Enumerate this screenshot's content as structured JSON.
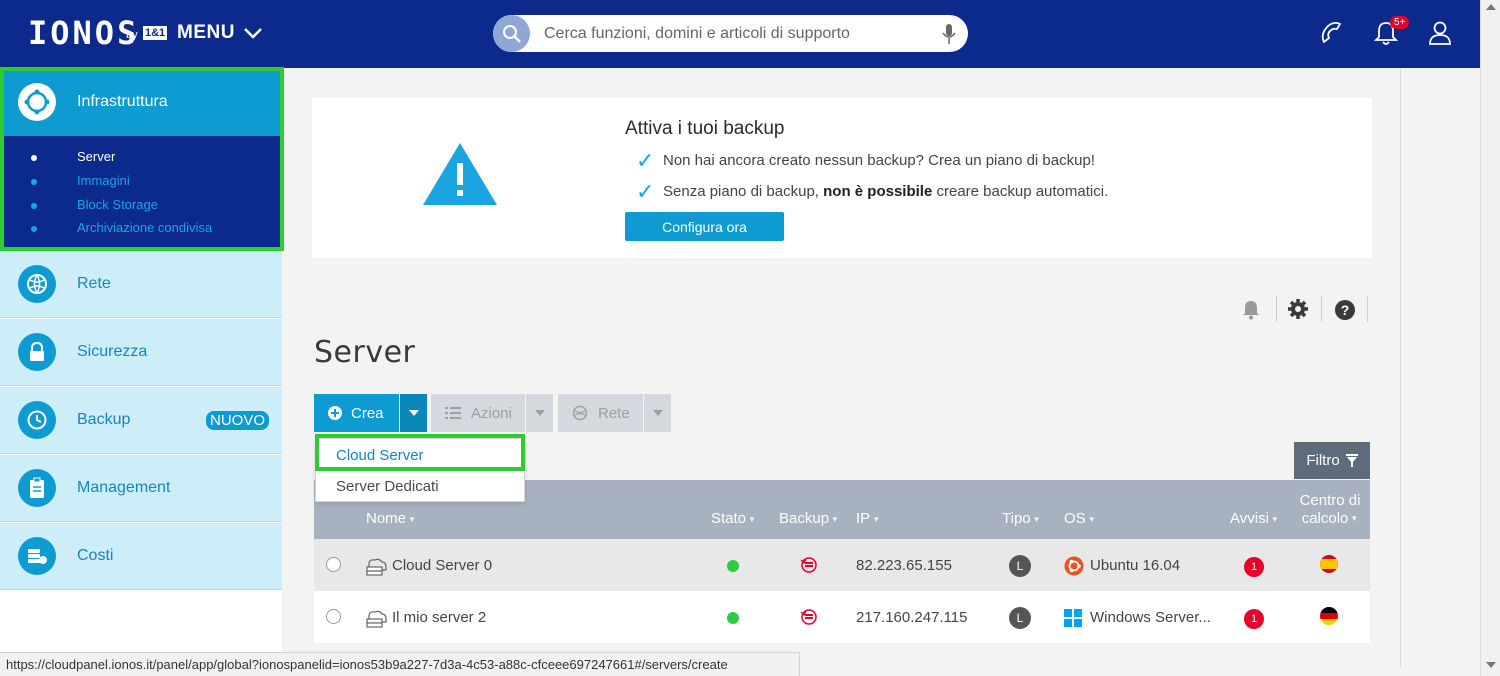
{
  "header": {
    "logo_text": "IONOS",
    "logo_by": "by",
    "logo_brand": "1&1",
    "menu_label": "MENU",
    "search_placeholder": "Cerca funzioni, domini e articoli di supporto",
    "notification_badge": "5+",
    "icons": [
      "phone-icon",
      "bell-icon",
      "user-icon"
    ]
  },
  "sidebar": {
    "items": [
      {
        "label": "Infrastruttura",
        "icon": "infrastructure-icon",
        "active": true
      },
      {
        "label": "Rete",
        "icon": "network-globe-icon"
      },
      {
        "label": "Sicurezza",
        "icon": "lock-icon"
      },
      {
        "label": "Backup",
        "icon": "backup-clock-icon",
        "badge": "NUOVO"
      },
      {
        "label": "Management",
        "icon": "clipboard-icon"
      },
      {
        "label": "Costi",
        "icon": "coins-icon"
      }
    ],
    "subitems": [
      {
        "label": "Server",
        "active": true
      },
      {
        "label": "Immagini"
      },
      {
        "label": "Block Storage"
      },
      {
        "label": "Archiviazione condivisa"
      }
    ]
  },
  "alert": {
    "title": "Attiva i tuoi backup",
    "line1": "Non hai ancora creato nessun backup? Crea un piano di backup!",
    "line2_before": "Senza piano di backup, ",
    "line2_bold": "non è possibile",
    "line2_after": " creare backup automatici.",
    "button": "Configura ora",
    "icon": "warning-triangle-icon"
  },
  "page": {
    "title": "Server",
    "tool_icons": [
      "bell-icon",
      "gear-icon",
      "help-icon"
    ]
  },
  "toolbar": {
    "crea": "Crea",
    "azioni": "Azioni",
    "rete": "Rete"
  },
  "dropdown": {
    "items": [
      "Cloud Server",
      "Server Dedicati"
    ]
  },
  "filter": {
    "label": "Filtro"
  },
  "table": {
    "columns": {
      "nome": "Nome",
      "stato": "Stato",
      "backup": "Backup",
      "ip": "IP",
      "tipo": "Tipo",
      "os": "OS",
      "avvisi": "Avvisi",
      "centro_line1": "Centro di",
      "centro_line2": "calcolo"
    },
    "rows": [
      {
        "name": "Cloud Server 0",
        "status": "online",
        "ip": "82.223.65.155",
        "tipo": "L",
        "os": "Ubuntu 16.04",
        "os_icon": "ubuntu-icon",
        "avvisi": "1",
        "datacenter_flag": "spain-flag-icon"
      },
      {
        "name": "Il mio server 2",
        "status": "online",
        "ip": "217.160.247.115",
        "tipo": "L",
        "os": "Windows Server...",
        "os_icon": "windows-icon",
        "avvisi": "1",
        "datacenter_flag": "germany-flag-icon"
      }
    ]
  },
  "status_bar": {
    "url": "https://cloudpanel.ionos.it/panel/app/global?ionospanelid=ionos53b9a227-7d3a-4c53-a88c-cfceee697247661#/servers/create"
  },
  "colors": {
    "brand_dark": "#0b2a8c",
    "accent": "#0d9bd1",
    "highlight": "#2ecc2e",
    "status_online": "#2ecc40",
    "alert_red": "#e4002b"
  }
}
